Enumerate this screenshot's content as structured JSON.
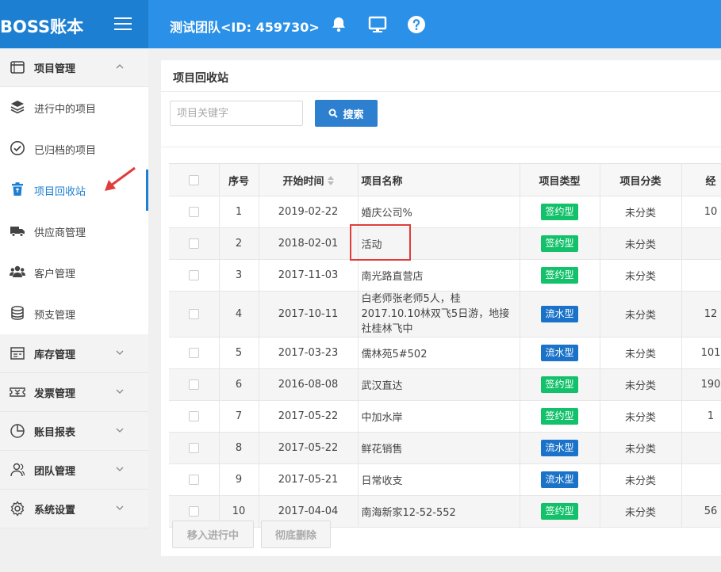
{
  "header": {
    "logo": "BOSS账本",
    "team": "测试团队<ID: 459730>"
  },
  "icons": {
    "menu": "menu-icon",
    "bell": "bell-icon",
    "monitor": "monitor-icon",
    "help": "question-circle-icon"
  },
  "sidebar": {
    "project_group": "项目管理",
    "items": [
      {
        "label": "进行中的项目",
        "icon": "layers-icon"
      },
      {
        "label": "已归档的项目",
        "icon": "check-circle-icon"
      },
      {
        "label": "项目回收站",
        "icon": "trash-icon"
      },
      {
        "label": "供应商管理",
        "icon": "truck-icon"
      },
      {
        "label": "客户管理",
        "icon": "users-icon"
      },
      {
        "label": "预支管理",
        "icon": "coins-icon"
      }
    ],
    "groups": [
      {
        "label": "库存管理",
        "icon": "inventory-icon"
      },
      {
        "label": "发票管理",
        "icon": "invoice-icon"
      },
      {
        "label": "账目报表",
        "icon": "pie-chart-icon"
      },
      {
        "label": "团队管理",
        "icon": "team-icon"
      },
      {
        "label": "系统设置",
        "icon": "settings-icon"
      }
    ],
    "accent": "#1c7fd2"
  },
  "main": {
    "title": "项目回收站",
    "search": {
      "placeholder": "项目关键字",
      "value": "",
      "button": "搜索"
    },
    "table": {
      "columns": [
        "",
        "序号",
        "开始时间",
        "项目名称",
        "项目类型",
        "项目分类",
        "经"
      ],
      "rows": [
        {
          "no": "1",
          "date": "2019-02-22",
          "name": "婚庆公司%",
          "type": "签约型",
          "category": "未分类",
          "extra": "10"
        },
        {
          "no": "2",
          "date": "2018-02-01",
          "name": "活动",
          "type": "签约型",
          "category": "未分类",
          "extra": ""
        },
        {
          "no": "3",
          "date": "2017-11-03",
          "name": "南光路直营店",
          "type": "签约型",
          "category": "未分类",
          "extra": ""
        },
        {
          "no": "4",
          "date": "2017-10-11",
          "name": "白老师张老师5人，桂2017.10.10林双飞5日游，地接社桂林飞中",
          "type": "流水型",
          "category": "未分类",
          "extra": "12"
        },
        {
          "no": "5",
          "date": "2017-03-23",
          "name": "儒林苑5#502",
          "type": "流水型",
          "category": "未分类",
          "extra": "101"
        },
        {
          "no": "6",
          "date": "2016-08-08",
          "name": "武汉直达",
          "type": "签约型",
          "category": "未分类",
          "extra": "190"
        },
        {
          "no": "7",
          "date": "2017-05-22",
          "name": "中加水岸",
          "type": "签约型",
          "category": "未分类",
          "extra": "1"
        },
        {
          "no": "8",
          "date": "2017-05-22",
          "name": "鲜花销售",
          "type": "流水型",
          "category": "未分类",
          "extra": ""
        },
        {
          "no": "9",
          "date": "2017-05-21",
          "name": "日常收支",
          "type": "流水型",
          "category": "未分类",
          "extra": ""
        },
        {
          "no": "10",
          "date": "2017-04-04",
          "name": "南海新家12-52-552",
          "type": "签约型",
          "category": "未分类",
          "extra": "56"
        }
      ],
      "type_colors": {
        "签约型": "#12c16a",
        "流水型": "#1a72c9"
      }
    },
    "buttons": {
      "restore": "移入进行中",
      "delete": "彻底删除"
    }
  }
}
